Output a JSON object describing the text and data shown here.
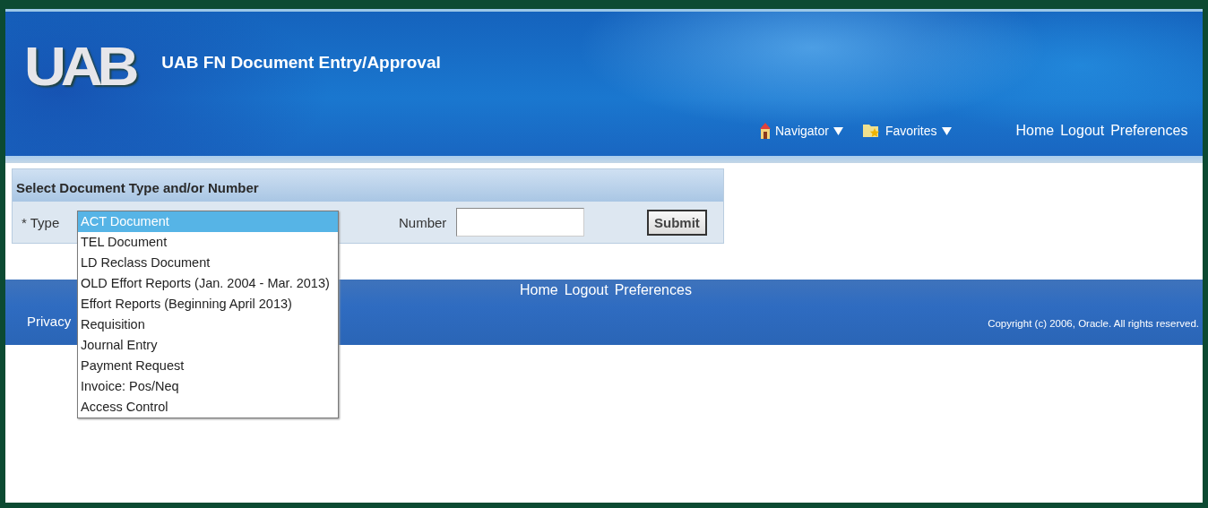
{
  "header": {
    "logo": "UAB",
    "title": "UAB FN Document Entry/Approval",
    "menus": [
      {
        "label": "Navigator",
        "kind": "navigator"
      },
      {
        "label": "Favorites",
        "kind": "favorites"
      }
    ],
    "links": [
      "Home",
      "Logout",
      "Preferences"
    ]
  },
  "panel": {
    "title": "Select Document Type and/or Number",
    "type_label": "* Type",
    "type_dropdown": {
      "expanded": true,
      "options": [
        {
          "label": "ACT Document",
          "selected": true
        },
        {
          "label": "TEL Document",
          "selected": false
        },
        {
          "label": "LD Reclass Document",
          "selected": false
        },
        {
          "label": "OLD Effort Reports (Jan. 2004 - Mar. 2013)",
          "selected": false
        },
        {
          "label": "Effort Reports (Beginning April 2013)",
          "selected": false
        },
        {
          "label": "Requisition",
          "selected": false
        },
        {
          "label": "Journal Entry",
          "selected": false
        },
        {
          "label": "Payment Request",
          "selected": false
        },
        {
          "label": "Invoice: Pos/Neq",
          "selected": false
        },
        {
          "label": "Access Control",
          "selected": false
        }
      ]
    },
    "number_label": "Number",
    "submit": "Submit"
  },
  "footer": {
    "links": [
      "Home",
      "Logout",
      "Preferences"
    ],
    "privacy": "Privacy",
    "copyright": "Copyright (c) 2006, Oracle. All rights reserved."
  }
}
